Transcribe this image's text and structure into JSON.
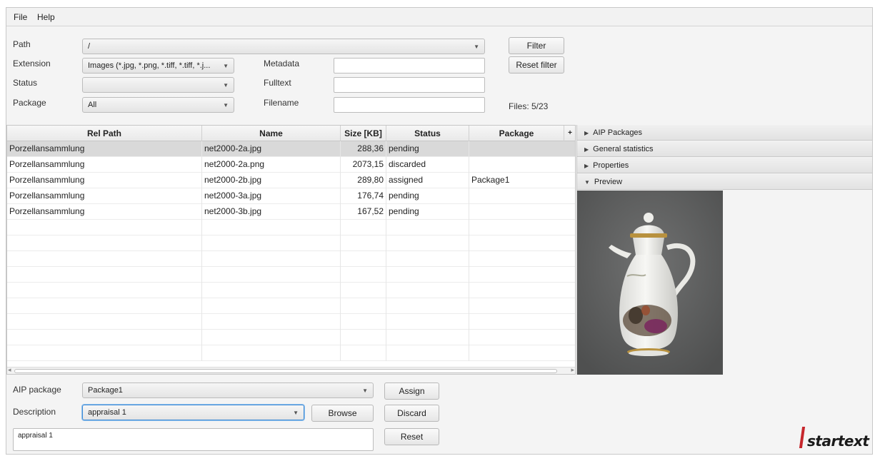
{
  "menu": {
    "file": "File",
    "help": "Help"
  },
  "filters": {
    "path_label": "Path",
    "path_value": "/",
    "extension_label": "Extension",
    "extension_value": "Images (*.jpg, *.png, *.tiff, *.tiff, *.j...",
    "status_label": "Status",
    "status_value": "",
    "package_label": "Package",
    "package_value": "All",
    "metadata_label": "Metadata",
    "metadata_value": "",
    "fulltext_label": "Fulltext",
    "fulltext_value": "",
    "filename_label": "Filename",
    "filename_value": "",
    "filter_button": "Filter",
    "reset_filter_button": "Reset filter",
    "files_count": "Files: 5/23"
  },
  "table": {
    "headers": [
      "Rel Path",
      "Name",
      "Size [KB]",
      "Status",
      "Package"
    ],
    "add_column_icon": "+",
    "rows": [
      {
        "rel_path": "Porzellansammlung",
        "name": "net2000-2a.jpg",
        "size": "288,36",
        "status": "pending",
        "package": "",
        "selected": true
      },
      {
        "rel_path": "Porzellansammlung",
        "name": "net2000-2a.png",
        "size": "2073,15",
        "status": "discarded",
        "package": ""
      },
      {
        "rel_path": "Porzellansammlung",
        "name": "net2000-2b.jpg",
        "size": "289,80",
        "status": "assigned",
        "package": "Package1"
      },
      {
        "rel_path": "Porzellansammlung",
        "name": "net2000-3a.jpg",
        "size": "176,74",
        "status": "pending",
        "package": ""
      },
      {
        "rel_path": "Porzellansammlung",
        "name": "net2000-3b.jpg",
        "size": "167,52",
        "status": "pending",
        "package": ""
      }
    ]
  },
  "side_panel": {
    "sections": [
      {
        "label": "AIP Packages",
        "expanded": false
      },
      {
        "label": "General statistics",
        "expanded": false
      },
      {
        "label": "Properties",
        "expanded": false
      },
      {
        "label": "Preview",
        "expanded": true
      }
    ],
    "preview_image": "porcelain coffee pot"
  },
  "bottom": {
    "aip_label": "AIP package",
    "aip_value": "Package1",
    "description_label": "Description",
    "description_value": "appraisal 1",
    "description_text": "appraisal 1",
    "browse_button": "Browse",
    "assign_button": "Assign",
    "discard_button": "Discard",
    "reset_button": "Reset"
  },
  "logo": {
    "text": "startext"
  },
  "colors": {
    "logo_accent": "#c6262c",
    "selected_row": "#d9d9d9",
    "focus": "#3d8ad6"
  }
}
